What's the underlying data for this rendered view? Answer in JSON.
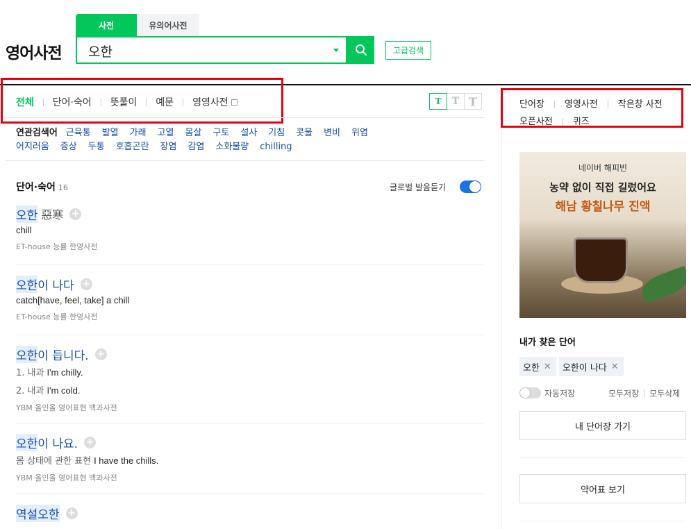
{
  "logo": "영어사전",
  "search_tabs": [
    "사전",
    "유의어사전"
  ],
  "search": {
    "value": "오한",
    "advanced_label": "고급검색"
  },
  "filter_tabs": [
    "전체",
    "단어·숙어",
    "뜻풀이",
    "예문",
    "영영사전"
  ],
  "font_buttons": [
    "T",
    "T",
    "T"
  ],
  "related": {
    "label": "연관검색어",
    "items": [
      "근육통",
      "발열",
      "가래",
      "고열",
      "몸살",
      "구토",
      "설사",
      "기침",
      "콧물",
      "변비",
      "위염",
      "어지러움",
      "증상",
      "두통",
      "호흡곤란",
      "장염",
      "감염",
      "소화불량",
      "chilling"
    ]
  },
  "section": {
    "title": "단어·숙어",
    "count": "16",
    "global_label": "글로벌 발음듣기"
  },
  "entries": [
    {
      "word": "오한",
      "rest": "",
      "hanja": "惡寒",
      "meanings": [
        {
          "ko": "",
          "en": "chill"
        }
      ],
      "source": "ET-house 능률 한영사전"
    },
    {
      "word": "오한",
      "rest": "이 나다",
      "hanja": "",
      "meanings": [
        {
          "ko": "",
          "en": "catch[have, feel, take] a chill"
        }
      ],
      "source": "ET-house 능률 한영사전"
    },
    {
      "word": "오한",
      "rest": "이 듭니다.",
      "hanja": "",
      "meanings": [
        {
          "ko": "1. 내과",
          "en": "I'm chilly."
        },
        {
          "ko": "2. 내과",
          "en": "I'm cold."
        }
      ],
      "source": "YBM 올인올 영어표현 백과사전"
    },
    {
      "word": "오한",
      "rest": "이 나요.",
      "hanja": "",
      "meanings": [
        {
          "ko": "몸 상태에 관한 표현",
          "en": "I have the chills."
        }
      ],
      "source": "YBM 올인올 영어표현 백과사전"
    },
    {
      "word": "역설오한",
      "rest": "",
      "hanja": "",
      "meanings": [],
      "source": ""
    }
  ],
  "right_links": {
    "row1": [
      "단어장",
      "영영사전",
      "작은창 사전"
    ],
    "row2": [
      "오픈사전",
      "퀴즈"
    ]
  },
  "ad": {
    "sub": "네이버 해피빈",
    "line1": "농약 없이 직접 길렀어요",
    "line2": "해남 황칠나무 진액"
  },
  "my_words": {
    "title": "내가 찾은 단어",
    "chips": [
      "오한",
      "오한이 나다"
    ],
    "auto_save": "자동저장",
    "save_all": "모두저장",
    "delete_all": "모두삭제"
  },
  "buttons": {
    "wordbook": "내 단어장 가기",
    "abbr": "약어표 보기"
  },
  "colors": {
    "accent": "#03c75a",
    "link": "#1a4ea8",
    "highlight_box": "#e60012"
  }
}
